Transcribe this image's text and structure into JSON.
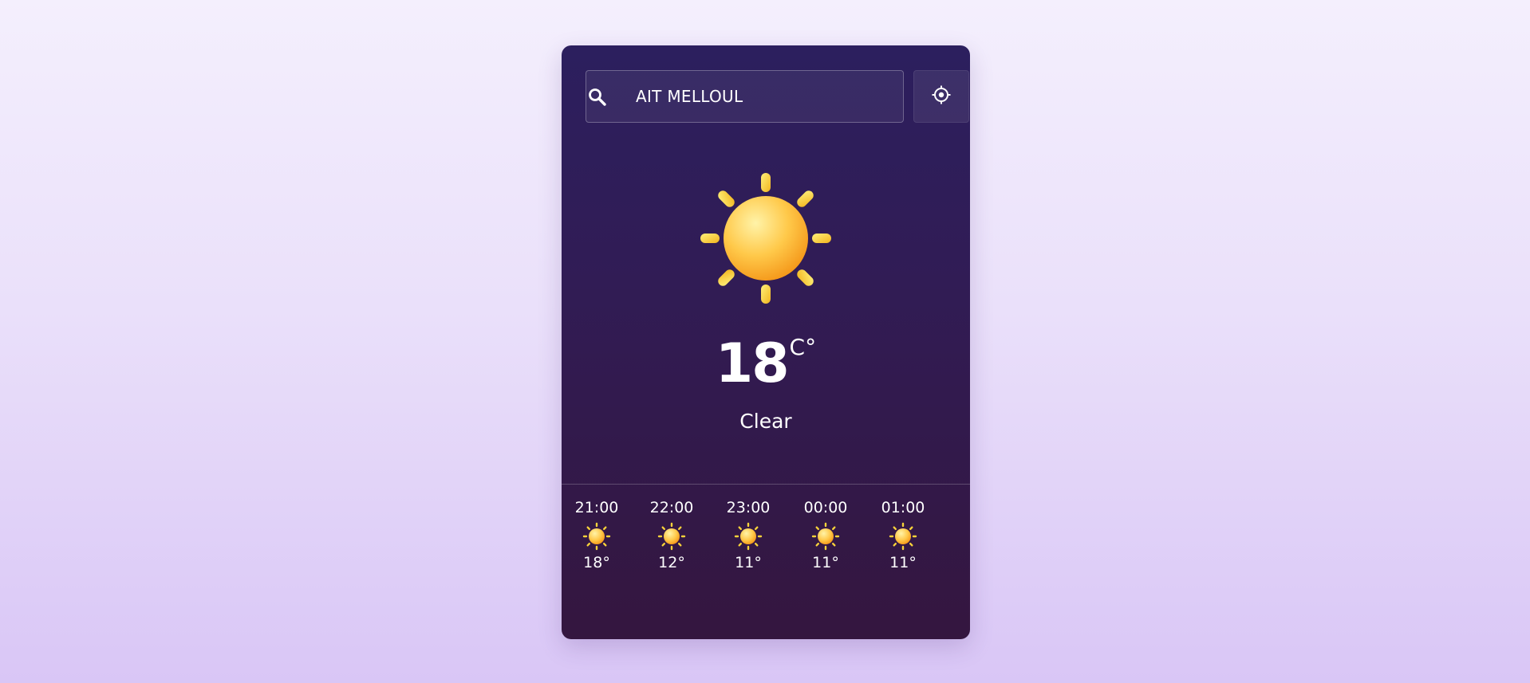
{
  "search": {
    "value": "AIT MELLOUL",
    "icon": "search-icon"
  },
  "locate": {
    "icon": "crosshair-icon"
  },
  "current": {
    "temperature": "18",
    "unit": "C°",
    "condition": "Clear",
    "icon": "sun-icon"
  },
  "hourly": [
    {
      "time": "21:00",
      "temp": "18°",
      "icon": "sun-icon"
    },
    {
      "time": "22:00",
      "temp": "12°",
      "icon": "sun-icon"
    },
    {
      "time": "23:00",
      "temp": "11°",
      "icon": "sun-icon"
    },
    {
      "time": "00:00",
      "temp": "11°",
      "icon": "sun-icon"
    },
    {
      "time": "01:00",
      "temp": "11°",
      "icon": "sun-icon"
    }
  ],
  "colors": {
    "card_top": "#2c1f5e",
    "card_bottom": "#34163f",
    "sun_core": "#ffc83a",
    "sun_ray": "#f7d23a"
  }
}
